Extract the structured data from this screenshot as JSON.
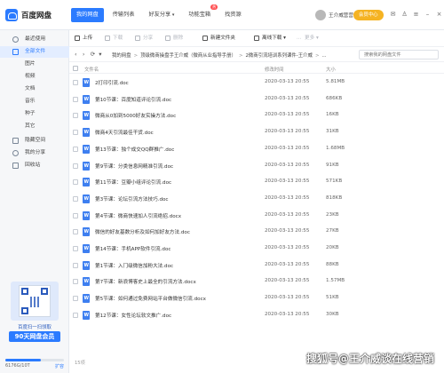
{
  "app": {
    "logo_text": "百度网盘"
  },
  "nav": {
    "items": [
      {
        "label": "我的网盘",
        "active": true
      },
      {
        "label": "传输列表"
      },
      {
        "label": "好友分享"
      },
      {
        "label": "功能宝箱"
      },
      {
        "label": "找资源"
      }
    ],
    "hot_badge": "热",
    "user_name": "王介威营营销",
    "member_button": "会员中心"
  },
  "sidebar": {
    "items": [
      {
        "label": "最近使用",
        "icon": "clock-icon"
      },
      {
        "label": "全部文件",
        "icon": "folder-icon",
        "active": true
      },
      {
        "label": "图片"
      },
      {
        "label": "视频"
      },
      {
        "label": "文档"
      },
      {
        "label": "音乐"
      },
      {
        "label": "种子"
      },
      {
        "label": "其它"
      },
      {
        "label": "隐藏空间",
        "icon": "lock-icon"
      },
      {
        "label": "我的分享",
        "icon": "share-icon"
      },
      {
        "label": "回收站",
        "icon": "trash-icon"
      }
    ],
    "promo": {
      "sub": "百度扫一扫领取",
      "main": "90天网盘会员"
    },
    "storage": {
      "text": "6176G/10T",
      "expand": "扩容",
      "used_fraction": 0.6
    }
  },
  "toolbar": {
    "items": [
      {
        "label": "上传",
        "enabled": true
      },
      {
        "label": "下载",
        "enabled": false
      },
      {
        "label": "分享",
        "enabled": false
      },
      {
        "label": "删除",
        "enabled": false
      },
      {
        "label": "新建文件夹",
        "enabled": true
      },
      {
        "label": "离线下载",
        "enabled": true
      },
      {
        "label": "更多",
        "enabled": false
      }
    ]
  },
  "breadcrumb": {
    "parts": [
      "我的网盘",
      "顶级微商操盘手王介威（微商从业指导手册）",
      "2微商引流培训系列课件-王介威",
      "..."
    ],
    "search_placeholder": "搜索我的网盘文件"
  },
  "table": {
    "headers": {
      "name": "文件名",
      "date": "修改时间",
      "size": "大小"
    },
    "rows": [
      {
        "name": "2打印引流.doc",
        "date": "2020-03-13 20:55",
        "size": "5.81MB"
      },
      {
        "name": "第10节课：百度知道评论引流.doc",
        "date": "2020-03-13 20:55",
        "size": "686KB"
      },
      {
        "name": "微商从0加到5000好友实操方法.doc",
        "date": "2020-03-13 20:55",
        "size": "16KB"
      },
      {
        "name": "微商4天引流最佳干货.doc",
        "date": "2020-03-13 20:55",
        "size": "31KB"
      },
      {
        "name": "第13节课：独个成交QQ群推广.doc",
        "date": "2020-03-13 20:55",
        "size": "1.68MB"
      },
      {
        "name": "第9节课：分类信息网精准引流.doc",
        "date": "2020-03-13 20:55",
        "size": "91KB"
      },
      {
        "name": "第11节课：豆瓣小组评论引流.doc",
        "date": "2020-03-13 20:55",
        "size": "571KB"
      },
      {
        "name": "第3节课：论坛引流方法技巧.doc",
        "date": "2020-03-13 20:55",
        "size": "818KB"
      },
      {
        "name": "第4节课：微商快速加人引流绝招.docx",
        "date": "2020-03-13 20:55",
        "size": "23KB"
      },
      {
        "name": "微信的好友基数分析及如何加好友方法.doc",
        "date": "2020-03-13 20:55",
        "size": "27KB"
      },
      {
        "name": "第14节课：手机APP软件引流.doc",
        "date": "2020-03-13 20:55",
        "size": "20KB"
      },
      {
        "name": "第1节课：入门级微信加粉大法.doc",
        "date": "2020-03-13 20:55",
        "size": "88KB"
      },
      {
        "name": "第7节课：新浪博客史上最全的引流方法.docx",
        "date": "2020-03-13 20:55",
        "size": "1.57MB"
      },
      {
        "name": "第5节课：如何通过免费网站平台做微信引流.docx",
        "date": "2020-03-13 20:55",
        "size": "51KB"
      },
      {
        "name": "第12节课：女性论坛软文推广.doc",
        "date": "2020-03-13 20:55",
        "size": "30KB"
      }
    ],
    "count_text": "15项"
  },
  "watermark": "搜狐号@王介威谈在线营销",
  "colors": {
    "accent": "#2b7bff",
    "member": "#f5b323",
    "sidebar_bg": "#f6f7f9"
  }
}
